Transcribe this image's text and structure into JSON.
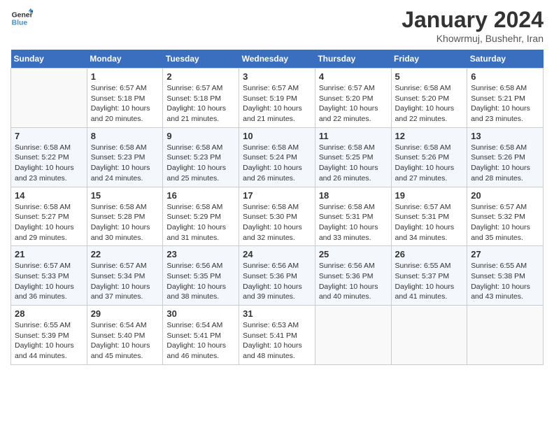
{
  "header": {
    "logo_line1": "General",
    "logo_line2": "Blue",
    "month": "January 2024",
    "location": "Khowrmuj, Bushehr, Iran"
  },
  "weekdays": [
    "Sunday",
    "Monday",
    "Tuesday",
    "Wednesday",
    "Thursday",
    "Friday",
    "Saturday"
  ],
  "weeks": [
    [
      {
        "day": "",
        "info": ""
      },
      {
        "day": "1",
        "info": "Sunrise: 6:57 AM\nSunset: 5:18 PM\nDaylight: 10 hours\nand 20 minutes."
      },
      {
        "day": "2",
        "info": "Sunrise: 6:57 AM\nSunset: 5:18 PM\nDaylight: 10 hours\nand 21 minutes."
      },
      {
        "day": "3",
        "info": "Sunrise: 6:57 AM\nSunset: 5:19 PM\nDaylight: 10 hours\nand 21 minutes."
      },
      {
        "day": "4",
        "info": "Sunrise: 6:57 AM\nSunset: 5:20 PM\nDaylight: 10 hours\nand 22 minutes."
      },
      {
        "day": "5",
        "info": "Sunrise: 6:58 AM\nSunset: 5:20 PM\nDaylight: 10 hours\nand 22 minutes."
      },
      {
        "day": "6",
        "info": "Sunrise: 6:58 AM\nSunset: 5:21 PM\nDaylight: 10 hours\nand 23 minutes."
      }
    ],
    [
      {
        "day": "7",
        "info": "Sunrise: 6:58 AM\nSunset: 5:22 PM\nDaylight: 10 hours\nand 23 minutes."
      },
      {
        "day": "8",
        "info": "Sunrise: 6:58 AM\nSunset: 5:23 PM\nDaylight: 10 hours\nand 24 minutes."
      },
      {
        "day": "9",
        "info": "Sunrise: 6:58 AM\nSunset: 5:23 PM\nDaylight: 10 hours\nand 25 minutes."
      },
      {
        "day": "10",
        "info": "Sunrise: 6:58 AM\nSunset: 5:24 PM\nDaylight: 10 hours\nand 26 minutes."
      },
      {
        "day": "11",
        "info": "Sunrise: 6:58 AM\nSunset: 5:25 PM\nDaylight: 10 hours\nand 26 minutes."
      },
      {
        "day": "12",
        "info": "Sunrise: 6:58 AM\nSunset: 5:26 PM\nDaylight: 10 hours\nand 27 minutes."
      },
      {
        "day": "13",
        "info": "Sunrise: 6:58 AM\nSunset: 5:26 PM\nDaylight: 10 hours\nand 28 minutes."
      }
    ],
    [
      {
        "day": "14",
        "info": "Sunrise: 6:58 AM\nSunset: 5:27 PM\nDaylight: 10 hours\nand 29 minutes."
      },
      {
        "day": "15",
        "info": "Sunrise: 6:58 AM\nSunset: 5:28 PM\nDaylight: 10 hours\nand 30 minutes."
      },
      {
        "day": "16",
        "info": "Sunrise: 6:58 AM\nSunset: 5:29 PM\nDaylight: 10 hours\nand 31 minutes."
      },
      {
        "day": "17",
        "info": "Sunrise: 6:58 AM\nSunset: 5:30 PM\nDaylight: 10 hours\nand 32 minutes."
      },
      {
        "day": "18",
        "info": "Sunrise: 6:58 AM\nSunset: 5:31 PM\nDaylight: 10 hours\nand 33 minutes."
      },
      {
        "day": "19",
        "info": "Sunrise: 6:57 AM\nSunset: 5:31 PM\nDaylight: 10 hours\nand 34 minutes."
      },
      {
        "day": "20",
        "info": "Sunrise: 6:57 AM\nSunset: 5:32 PM\nDaylight: 10 hours\nand 35 minutes."
      }
    ],
    [
      {
        "day": "21",
        "info": "Sunrise: 6:57 AM\nSunset: 5:33 PM\nDaylight: 10 hours\nand 36 minutes."
      },
      {
        "day": "22",
        "info": "Sunrise: 6:57 AM\nSunset: 5:34 PM\nDaylight: 10 hours\nand 37 minutes."
      },
      {
        "day": "23",
        "info": "Sunrise: 6:56 AM\nSunset: 5:35 PM\nDaylight: 10 hours\nand 38 minutes."
      },
      {
        "day": "24",
        "info": "Sunrise: 6:56 AM\nSunset: 5:36 PM\nDaylight: 10 hours\nand 39 minutes."
      },
      {
        "day": "25",
        "info": "Sunrise: 6:56 AM\nSunset: 5:36 PM\nDaylight: 10 hours\nand 40 minutes."
      },
      {
        "day": "26",
        "info": "Sunrise: 6:55 AM\nSunset: 5:37 PM\nDaylight: 10 hours\nand 41 minutes."
      },
      {
        "day": "27",
        "info": "Sunrise: 6:55 AM\nSunset: 5:38 PM\nDaylight: 10 hours\nand 43 minutes."
      }
    ],
    [
      {
        "day": "28",
        "info": "Sunrise: 6:55 AM\nSunset: 5:39 PM\nDaylight: 10 hours\nand 44 minutes."
      },
      {
        "day": "29",
        "info": "Sunrise: 6:54 AM\nSunset: 5:40 PM\nDaylight: 10 hours\nand 45 minutes."
      },
      {
        "day": "30",
        "info": "Sunrise: 6:54 AM\nSunset: 5:41 PM\nDaylight: 10 hours\nand 46 minutes."
      },
      {
        "day": "31",
        "info": "Sunrise: 6:53 AM\nSunset: 5:41 PM\nDaylight: 10 hours\nand 48 minutes."
      },
      {
        "day": "",
        "info": ""
      },
      {
        "day": "",
        "info": ""
      },
      {
        "day": "",
        "info": ""
      }
    ]
  ]
}
